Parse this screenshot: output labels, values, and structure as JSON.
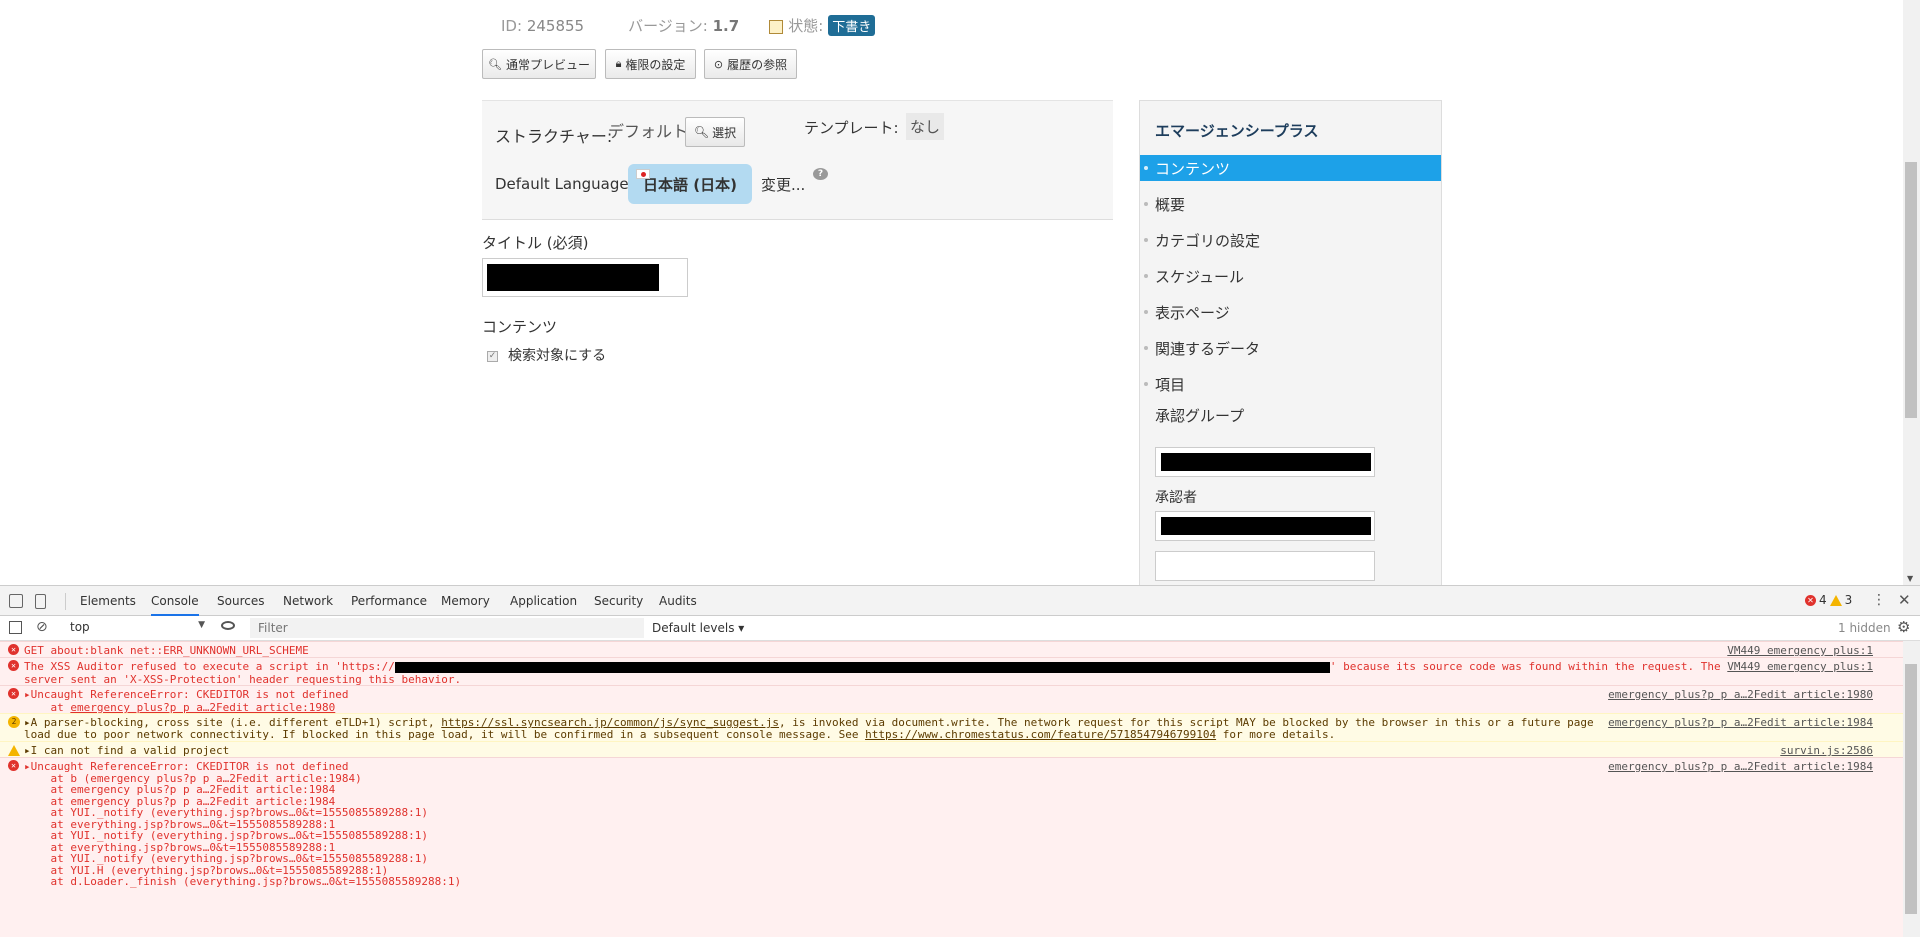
{
  "header": {
    "id_label": "ID:",
    "id_value": "245855",
    "version_label": "バージョン:",
    "version_value": "1.7",
    "status_label": "状態:",
    "status_value": "下書き"
  },
  "toolbar": {
    "preview_label": "通常プレビュー",
    "permissions_label": "権限の設定",
    "history_label": "履歴の参照"
  },
  "structure": {
    "label": "ストラクチャー:",
    "value": "デフォルト",
    "select_label": "選択",
    "template_label": "テンプレート:",
    "template_value": "なし"
  },
  "language": {
    "label": "Default Language:",
    "value": "日本語 (日本)",
    "change_label": "変更..."
  },
  "form": {
    "title_label": "タイトル (必須)",
    "content_label": "コンテンツ",
    "searchable_label": "検索対象にする"
  },
  "sidebar": {
    "title": "エマージェンシープラス",
    "items": [
      {
        "label": "コンテンツ",
        "active": true
      },
      {
        "label": "概要"
      },
      {
        "label": "カテゴリの設定"
      },
      {
        "label": "スケジュール"
      },
      {
        "label": "表示ページ"
      },
      {
        "label": "関連するデータ"
      },
      {
        "label": "項目"
      }
    ],
    "approval_group_label": "承認グループ",
    "approver_label": "承認者"
  },
  "devtools": {
    "tabs": [
      "Elements",
      "Console",
      "Sources",
      "Network",
      "Performance",
      "Memory",
      "Application",
      "Security",
      "Audits"
    ],
    "active_tab": "Console",
    "error_count": "4",
    "warning_count": "3",
    "context": "top",
    "filter_placeholder": "Filter",
    "levels": "Default levels ▾",
    "hidden": "1 hidden"
  },
  "console": {
    "m1": {
      "text": "GET about:blank net::ERR_UNKNOWN_URL_SCHEME",
      "src": "VM449 emergency plus:1"
    },
    "m2": {
      "pre": "The XSS Auditor refused to execute a script in 'https://",
      "post": "' because its source code was found within the request. The",
      "line2": "server sent an 'X-XSS-Protection' header requesting this behavior.",
      "src": "VM449 emergency plus:1"
    },
    "m3": {
      "text": "▸Uncaught ReferenceError: CKEDITOR is not defined",
      "line2a": "    at ",
      "line2b": "emergency plus?p p a…2Fedit article:1980",
      "src": "emergency plus?p p a…2Fedit article:1980"
    },
    "m4": {
      "badge": "2",
      "pre": "▸A parser-blocking, cross site (i.e. different eTLD+1) script, ",
      "url1": "https://ssl.syncsearch.jp/common/js/sync_suggest.js",
      "post": ", is invoked via document.write. The network request for this script MAY be blocked by the browser in this or a future page",
      "line2pre": "load due to poor network connectivity. If blocked in this page load, it will be confirmed in a subsequent console message. See ",
      "url2": "https://www.chromestatus.com/feature/5718547946799104",
      "line2post": " for more details.",
      "src": "emergency plus?p p a…2Fedit article:1984"
    },
    "m5": {
      "text": "▸I can not find a valid project",
      "src": "survin.js:2586"
    },
    "m6": {
      "text": "▸Uncaught ReferenceError: CKEDITOR is not defined",
      "src": "emergency plus?p p a…2Fedit article:1984",
      "stack": [
        "    at b (emergency plus?p p a…2Fedit article:1984)",
        "    at emergency plus?p p a…2Fedit article:1984",
        "    at emergency plus?p p a…2Fedit article:1984",
        "    at YUI._notify (everything.jsp?brows…0&t=1555085589288:1)",
        "    at everything.jsp?brows…0&t=1555085589288:1",
        "    at YUI._notify (everything.jsp?brows…0&t=1555085589288:1)",
        "    at everything.jsp?brows…0&t=1555085589288:1",
        "    at YUI._notify (everything.jsp?brows…0&t=1555085589288:1)",
        "    at YUI.H (everything.jsp?brows…0&t=1555085589288:1)",
        "    at d.Loader._finish (everything.jsp?brows…0&t=1555085589288:1)"
      ]
    }
  },
  "colors": {
    "accent": "#1da1e8",
    "status_badge": "#1f6d96",
    "language_pill": "#b3daf1",
    "error": "#e0322d",
    "warning": "#f4b400"
  }
}
